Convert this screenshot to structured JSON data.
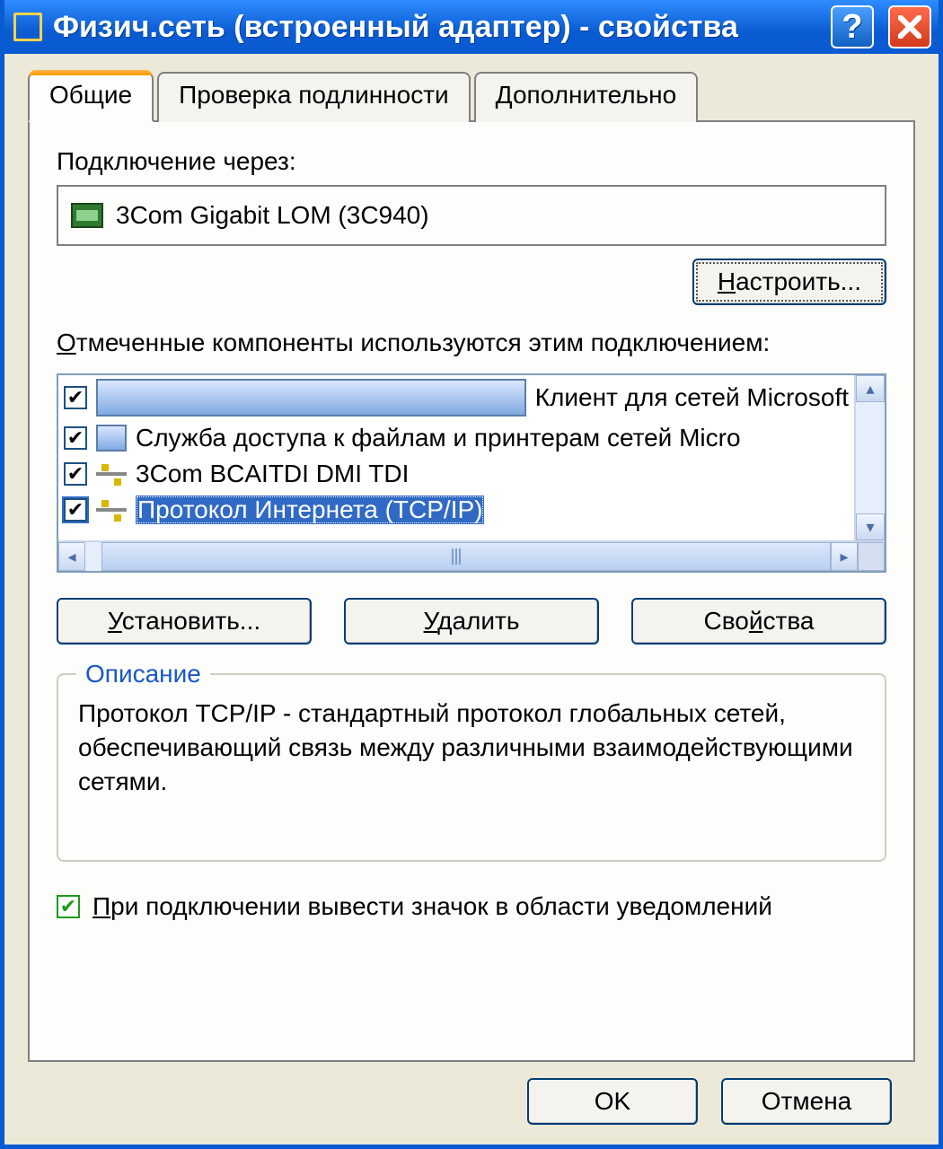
{
  "window": {
    "title": "Физич.сеть (встроенный адаптер) - свойства"
  },
  "tabs": {
    "general": "Общие",
    "auth": "Проверка подлинности",
    "advanced": "Дополнительно",
    "active": 0
  },
  "general": {
    "connect_label": "Подключение через:",
    "adapter": "3Com Gigabit LOM (3C940)",
    "configure_btn": "Настроить...",
    "components_label": "Отмеченные компоненты используются этим подключением:",
    "components": [
      {
        "checked": true,
        "icon": "client",
        "text": "Клиент для сетей Microsoft",
        "selected": false
      },
      {
        "checked": true,
        "icon": "service",
        "text": "Служба доступа к файлам и принтерам сетей Micro",
        "selected": false
      },
      {
        "checked": true,
        "icon": "protocol",
        "text": "3Com BCAITDI DMI TDI",
        "selected": false
      },
      {
        "checked": true,
        "icon": "protocol",
        "text": "Протокол Интернета (TCP/IP)",
        "selected": true
      }
    ],
    "install_btn": "Установить...",
    "remove_btn": "Удалить",
    "props_btn": "Свойства",
    "desc_title": "Описание",
    "desc_text": "Протокол TCP/IP - стандартный протокол глобальных сетей, обеспечивающий связь между различными взаимодействующими сетями.",
    "tray_check": true,
    "tray_label": "При подключении вывести значок в области уведомлений"
  },
  "buttons": {
    "ok": "OK",
    "cancel": "Отмена"
  }
}
